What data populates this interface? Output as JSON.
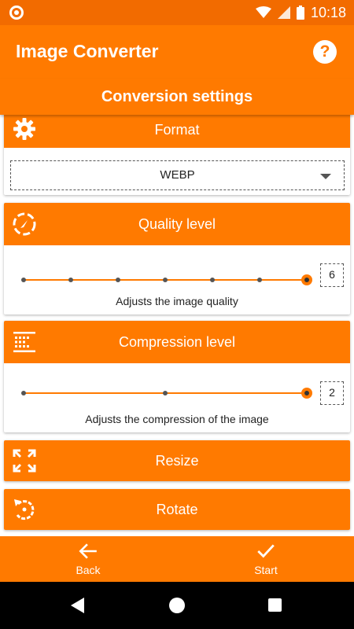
{
  "status_bar": {
    "time": "10:18"
  },
  "app_bar": {
    "title": "Image Converter",
    "help_label": "?"
  },
  "subheader": {
    "title": "Conversion settings"
  },
  "format": {
    "title": "Format",
    "selected": "WEBP"
  },
  "quality": {
    "title": "Quality level",
    "value": "6",
    "caption": "Adjusts the image quality",
    "ticks": 7,
    "selected_index": 6
  },
  "compression": {
    "title": "Compression level",
    "value": "2",
    "caption": "Adjusts the compression of the image",
    "ticks": 3,
    "selected_index": 2
  },
  "resize": {
    "title": "Resize"
  },
  "rotate": {
    "title": "Rotate"
  },
  "bottom_bar": {
    "back_label": "Back",
    "start_label": "Start"
  },
  "colors": {
    "accent": "#ff7a00",
    "status": "#f26b00"
  }
}
